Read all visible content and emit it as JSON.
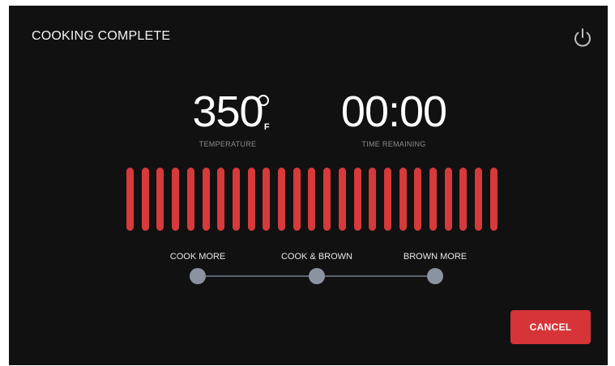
{
  "header": {
    "title": "COOKING COMPLETE",
    "power_icon": "power-icon"
  },
  "temperature": {
    "value": "350",
    "unit": "F",
    "caption": "TEMPERATURE"
  },
  "timer": {
    "value": "00:00",
    "caption": "TIME REMAINING"
  },
  "heat_bars": {
    "count": 25,
    "color": "#d63a3a"
  },
  "finish_slider": {
    "options": [
      "COOK MORE",
      "COOK & BROWN",
      "BROWN MORE"
    ],
    "knob_color": "#8c93a0",
    "track_color": "#5c6370"
  },
  "actions": {
    "cancel_label": "CANCEL",
    "cancel_color": "#d63438"
  }
}
